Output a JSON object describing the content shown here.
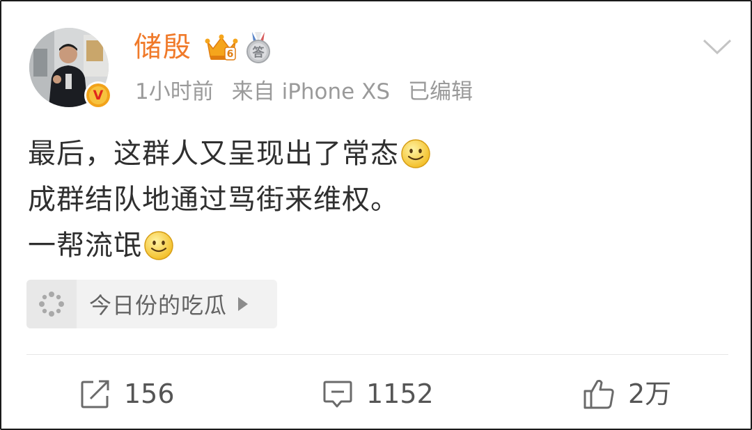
{
  "post": {
    "username": "储殷",
    "meta": {
      "time": "1小时前",
      "source": "来自 iPhone XS",
      "edited": "已编辑"
    },
    "lines": [
      {
        "text": "最后，这群人又呈现出了常态",
        "emoji": "smile-emoji"
      },
      {
        "text": "成群结队地通过骂街来维权。",
        "emoji": null
      },
      {
        "text": "一帮流氓",
        "emoji": "smile-emoji"
      }
    ]
  },
  "badges": {
    "crown_level": "6",
    "medal_label": "答"
  },
  "topic": {
    "label": "今日份的吃瓜",
    "icon": "topic-sparkle-icon"
  },
  "actions": {
    "repost_count": "156",
    "comment_count": "1152",
    "like_count": "2万"
  },
  "colors": {
    "username": "#f07a2a",
    "meta": "#9a9a9a",
    "text": "#2f2f2f",
    "chip_bg": "#f2f2f2",
    "verified_badge": "#f2a31b"
  }
}
